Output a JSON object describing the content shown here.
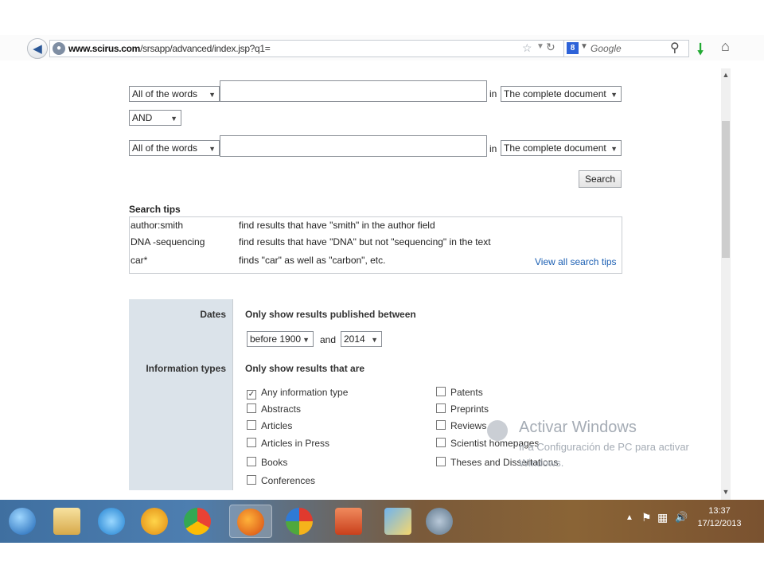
{
  "browser": {
    "url_host": "www.scirus.com",
    "url_path": "/srsapp/advanced/index.jsp?q1=",
    "search_engine": "Google"
  },
  "search_form": {
    "row1_scope": "All of the words",
    "row1_field": "The complete document",
    "operator": "AND",
    "row2_scope": "All of the words",
    "row2_field": "The complete document",
    "in_label": "in",
    "search_button": "Search"
  },
  "search_tips": {
    "title": "Search tips",
    "rows": [
      {
        "term": "author:smith",
        "description": "find results that have \"smith\" in the author field"
      },
      {
        "term": "DNA -sequencing",
        "description": "find results that have \"DNA\" but not \"sequencing\" in the text"
      },
      {
        "term": "car*",
        "description": "finds \"car\" as well as \"carbon\", etc."
      }
    ],
    "view_all": "View all search tips"
  },
  "filters": {
    "dates_label": "Dates",
    "dates_heading": "Only show results published between",
    "date_from": "before 1900",
    "and_label": "and",
    "date_to": "2014",
    "types_label": "Information types",
    "types_heading": "Only show results that are",
    "types_left": [
      {
        "label": "Any information type",
        "checked": true
      },
      {
        "label": "Abstracts",
        "checked": false
      },
      {
        "label": "Articles",
        "checked": false
      },
      {
        "label": "Articles in Press",
        "checked": false
      },
      {
        "label": "Books",
        "checked": false
      },
      {
        "label": "Conferences",
        "checked": false
      }
    ],
    "types_right": [
      {
        "label": "Patents",
        "checked": false
      },
      {
        "label": "Preprints",
        "checked": false
      },
      {
        "label": "Reviews",
        "checked": false
      },
      {
        "label": "Scientist homepages",
        "checked": false
      },
      {
        "label": "Theses and Dissertations",
        "checked": false
      }
    ]
  },
  "watermark": {
    "title": "Activar Windows",
    "line1": "Ir a Configuración de PC para activar",
    "line2": "Windows."
  },
  "taskbar": {
    "clock_time": "13:37",
    "clock_date": "17/12/2013",
    "apps": [
      "start-orb",
      "file-explorer",
      "internet-explorer",
      "paint-app",
      "chrome",
      "firefox",
      "office-app",
      "powerpoint",
      "drawing-app",
      "media-app"
    ]
  }
}
